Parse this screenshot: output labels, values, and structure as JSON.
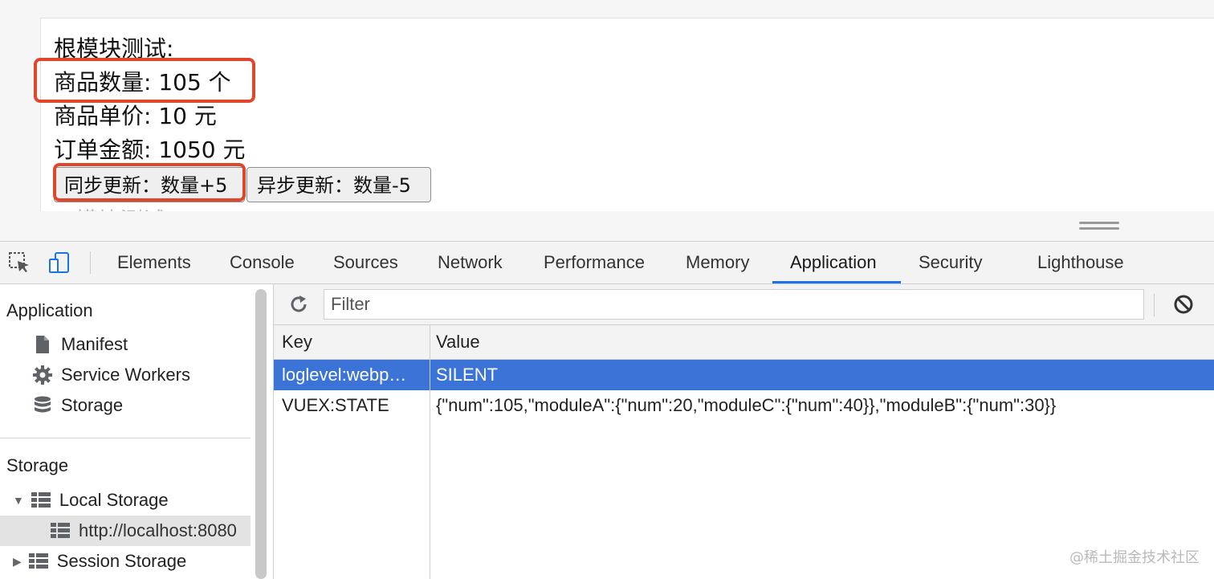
{
  "page": {
    "title": "根模块测试:",
    "quantity_line": "商品数量: 105 个",
    "price_line": "商品单价: 10 元",
    "total_line": "订单金额: 1050 元",
    "buttons": {
      "sync": "同步更新：数量+5",
      "async": "异步更新：数量-5"
    },
    "cut_off_text": "···模块测试"
  },
  "devtools": {
    "tabs": [
      "Elements",
      "Console",
      "Sources",
      "Network",
      "Performance",
      "Memory",
      "Application",
      "Security",
      "Lighthouse"
    ],
    "active_tab": "Application",
    "sidebar": {
      "application_header": "Application",
      "application_items": [
        "Manifest",
        "Service Workers",
        "Storage"
      ],
      "storage_header": "Storage",
      "local_storage": "Local Storage",
      "local_storage_origin": "http://localhost:8080",
      "session_storage": "Session Storage"
    },
    "filter": {
      "placeholder": "Filter"
    },
    "table": {
      "columns": [
        "Key",
        "Value"
      ],
      "rows": [
        {
          "key": "loglevel:webp…",
          "value": "SILENT"
        },
        {
          "key": "VUEX:STATE",
          "value": "{\"num\":105,\"moduleA\":{\"num\":20,\"moduleC\":{\"num\":40}},\"moduleB\":{\"num\":30}}"
        }
      ]
    }
  },
  "watermark": "@稀土掘金技术社区",
  "colors": {
    "highlight_red": "#e0462c",
    "selected_row": "#3b73d6",
    "active_tab_underline": "#1a73e8"
  }
}
